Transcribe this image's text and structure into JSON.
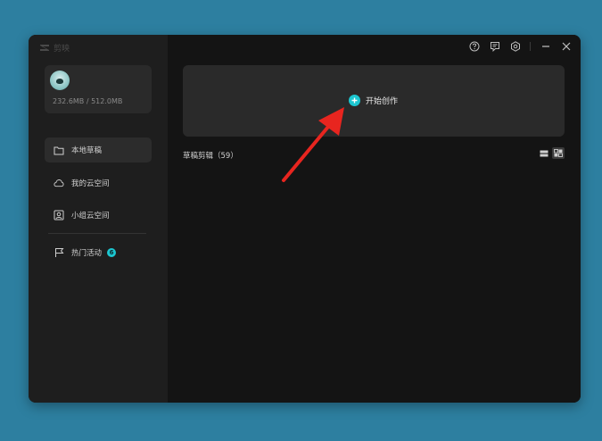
{
  "app": {
    "name": "剪映"
  },
  "user": {
    "storage": "232.6MB / 512.0MB"
  },
  "sidebar": {
    "items": [
      {
        "label": "本地草稿",
        "icon": "folder-icon",
        "active": true
      },
      {
        "label": "我的云空间",
        "icon": "cloud-icon",
        "active": false
      },
      {
        "label": "小组云空间",
        "icon": "team-icon",
        "active": false
      },
      {
        "label": "热门活动",
        "icon": "flag-icon",
        "active": false,
        "badge": "6"
      }
    ]
  },
  "titlebar": {
    "icons": [
      "help-icon",
      "feedback-icon",
      "settings-icon",
      "minimize-icon",
      "close-icon"
    ]
  },
  "main": {
    "create_label": "开始创作",
    "drafts_label": "草稿剪辑（59）"
  },
  "colors": {
    "accent": "#1cc6d0",
    "annotation_arrow": "#e8251f",
    "background": "#2d7fa0"
  }
}
